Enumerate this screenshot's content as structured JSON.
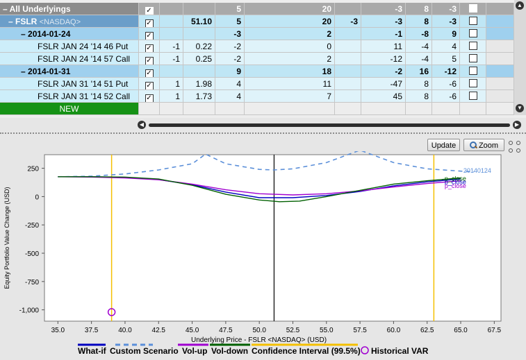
{
  "grid": {
    "header": {
      "label": "All Underlyings",
      "checked": true,
      "c4": "5",
      "c5": "20",
      "c7": "-3",
      "c8": "8",
      "c9": "-3"
    },
    "rows": [
      {
        "kind": "und",
        "label": "FSLR",
        "exchange": "<NASDAQ>",
        "checked": true,
        "c3": "51.10",
        "c4": "5",
        "c5": "20",
        "c6": "-3",
        "c7": "-3",
        "c8": "8",
        "c9": "-3"
      },
      {
        "kind": "exp",
        "label": "2014-01-24",
        "checked": true,
        "c4": "-3",
        "c5": "2",
        "c7": "-1",
        "c8": "-8",
        "c9": "9"
      },
      {
        "kind": "opt",
        "label": "FSLR JAN 24 '14 46 Put",
        "checked": true,
        "c2": "-1",
        "c3": "0.22",
        "c4": "-2",
        "c5": "0",
        "c7": "11",
        "c8": "-4",
        "c9": "4"
      },
      {
        "kind": "opt",
        "label": "FSLR JAN 24 '14 57 Call",
        "checked": true,
        "c2": "-1",
        "c3": "0.25",
        "c4": "-2",
        "c5": "2",
        "c7": "-12",
        "c8": "-4",
        "c9": "5"
      },
      {
        "kind": "exp",
        "label": "2014-01-31",
        "checked": true,
        "c4": "9",
        "c5": "18",
        "c7": "-2",
        "c8": "16",
        "c9": "-12"
      },
      {
        "kind": "opt",
        "label": "FSLR JAN 31 '14 51 Put",
        "checked": true,
        "c2": "1",
        "c3": "1.98",
        "c4": "4",
        "c5": "11",
        "c7": "-47",
        "c8": "8",
        "c9": "-6"
      },
      {
        "kind": "opt",
        "label": "FSLR JAN 31 '14 52 Call",
        "checked": true,
        "c2": "1",
        "c3": "1.73",
        "c4": "4",
        "c5": "7",
        "c7": "45",
        "c8": "8",
        "c9": "-6"
      },
      {
        "kind": "new",
        "label": "NEW"
      }
    ]
  },
  "toolbar": {
    "update_label": "Update",
    "zoom_label": "Zoom"
  },
  "chart_data": {
    "type": "line",
    "xlabel": "Underlying Price - FSLR <NASDAQ> (USD)",
    "ylabel": "Equity Portfolio Value Change (USD)",
    "xlim": [
      34,
      68
    ],
    "ylim": [
      -1100,
      370
    ],
    "xticks": [
      "35.0",
      "37.5",
      "40.0",
      "42.5",
      "45.0",
      "47.5",
      "50.0",
      "52.5",
      "55.0",
      "57.5",
      "60.0",
      "62.5",
      "65.0",
      "67.5"
    ],
    "yticks": [
      {
        "v": 250,
        "label": "250"
      },
      {
        "v": 0,
        "label": "0"
      },
      {
        "v": -250,
        "label": "-250"
      },
      {
        "v": -500,
        "label": "-500"
      },
      {
        "v": -750,
        "label": "-750"
      },
      {
        "v": -1000,
        "label": "-1,000"
      }
    ],
    "current_price": 51.1,
    "confidence_interval": [
      39.0,
      63.0
    ],
    "historical_var": {
      "x": 39.0,
      "y": -1020
    },
    "series": [
      {
        "name": "What-if",
        "color": "#0000c0",
        "dash": false,
        "x": [
          35,
          37.5,
          40,
          42.5,
          45,
          47.5,
          50,
          52.5,
          55,
          57.5,
          60,
          62.5,
          65
        ],
        "y": [
          175,
          175,
          170,
          150,
          105,
          40,
          -10,
          -10,
          10,
          45,
          95,
          130,
          155
        ]
      },
      {
        "name": "Custom Scenario",
        "color": "#5b8fd9",
        "dash": true,
        "x": [
          35,
          37.5,
          40,
          42.5,
          45,
          46,
          47.5,
          50,
          51.1,
          52.5,
          55,
          57.5,
          60,
          62.5,
          65,
          66
        ],
        "y": [
          175,
          180,
          200,
          235,
          290,
          375,
          290,
          240,
          235,
          245,
          300,
          410,
          300,
          245,
          225,
          220
        ]
      },
      {
        "name": "Vol-up",
        "color": "#a000d0",
        "dash": false,
        "x": [
          35,
          37.5,
          40,
          42.5,
          45,
          47.5,
          50,
          52.5,
          55,
          57.5,
          60,
          62.5,
          65
        ],
        "y": [
          175,
          172,
          165,
          148,
          110,
          60,
          25,
          15,
          25,
          50,
          85,
          115,
          140
        ]
      },
      {
        "name": "Vol-down",
        "color": "#006000",
        "dash": false,
        "x": [
          35,
          37.5,
          40,
          42.5,
          45,
          47.5,
          50,
          51.5,
          53,
          55,
          57.5,
          60,
          62.5,
          65
        ],
        "y": [
          175,
          175,
          172,
          155,
          100,
          20,
          -30,
          -45,
          -40,
          0,
          55,
          110,
          140,
          165
        ]
      },
      {
        "name": "Confidence Interval (99.5%)",
        "color": "#f5c000",
        "dash": false,
        "x": [],
        "y": []
      },
      {
        "name": "Historical VAR",
        "color": "#a000d0",
        "dash": false,
        "x": [],
        "y": []
      }
    ],
    "end_labels": [
      {
        "text": "20140124",
        "color": "#5b8fd9",
        "x": 65.2,
        "y": 230
      },
      {
        "text": "p_close",
        "color": "#006000",
        "x": 63.8,
        "y": 160
      },
      {
        "text": "p_close",
        "color": "#0000c0",
        "x": 63.8,
        "y": 127
      },
      {
        "text": "p_close",
        "color": "#a000d0",
        "x": 63.8,
        "y": 95
      }
    ]
  }
}
